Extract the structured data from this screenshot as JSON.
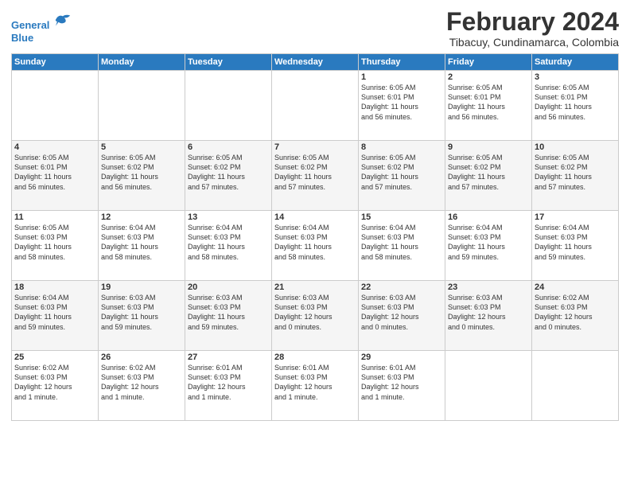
{
  "logo": {
    "line1": "General",
    "line2": "Blue"
  },
  "title": "February 2024",
  "subtitle": "Tibacuy, Cundinamarca, Colombia",
  "headers": [
    "Sunday",
    "Monday",
    "Tuesday",
    "Wednesday",
    "Thursday",
    "Friday",
    "Saturday"
  ],
  "weeks": [
    [
      {
        "day": "",
        "info": ""
      },
      {
        "day": "",
        "info": ""
      },
      {
        "day": "",
        "info": ""
      },
      {
        "day": "",
        "info": ""
      },
      {
        "day": "1",
        "info": "Sunrise: 6:05 AM\nSunset: 6:01 PM\nDaylight: 11 hours\nand 56 minutes."
      },
      {
        "day": "2",
        "info": "Sunrise: 6:05 AM\nSunset: 6:01 PM\nDaylight: 11 hours\nand 56 minutes."
      },
      {
        "day": "3",
        "info": "Sunrise: 6:05 AM\nSunset: 6:01 PM\nDaylight: 11 hours\nand 56 minutes."
      }
    ],
    [
      {
        "day": "4",
        "info": "Sunrise: 6:05 AM\nSunset: 6:01 PM\nDaylight: 11 hours\nand 56 minutes."
      },
      {
        "day": "5",
        "info": "Sunrise: 6:05 AM\nSunset: 6:02 PM\nDaylight: 11 hours\nand 56 minutes."
      },
      {
        "day": "6",
        "info": "Sunrise: 6:05 AM\nSunset: 6:02 PM\nDaylight: 11 hours\nand 57 minutes."
      },
      {
        "day": "7",
        "info": "Sunrise: 6:05 AM\nSunset: 6:02 PM\nDaylight: 11 hours\nand 57 minutes."
      },
      {
        "day": "8",
        "info": "Sunrise: 6:05 AM\nSunset: 6:02 PM\nDaylight: 11 hours\nand 57 minutes."
      },
      {
        "day": "9",
        "info": "Sunrise: 6:05 AM\nSunset: 6:02 PM\nDaylight: 11 hours\nand 57 minutes."
      },
      {
        "day": "10",
        "info": "Sunrise: 6:05 AM\nSunset: 6:02 PM\nDaylight: 11 hours\nand 57 minutes."
      }
    ],
    [
      {
        "day": "11",
        "info": "Sunrise: 6:05 AM\nSunset: 6:03 PM\nDaylight: 11 hours\nand 58 minutes."
      },
      {
        "day": "12",
        "info": "Sunrise: 6:04 AM\nSunset: 6:03 PM\nDaylight: 11 hours\nand 58 minutes."
      },
      {
        "day": "13",
        "info": "Sunrise: 6:04 AM\nSunset: 6:03 PM\nDaylight: 11 hours\nand 58 minutes."
      },
      {
        "day": "14",
        "info": "Sunrise: 6:04 AM\nSunset: 6:03 PM\nDaylight: 11 hours\nand 58 minutes."
      },
      {
        "day": "15",
        "info": "Sunrise: 6:04 AM\nSunset: 6:03 PM\nDaylight: 11 hours\nand 58 minutes."
      },
      {
        "day": "16",
        "info": "Sunrise: 6:04 AM\nSunset: 6:03 PM\nDaylight: 11 hours\nand 59 minutes."
      },
      {
        "day": "17",
        "info": "Sunrise: 6:04 AM\nSunset: 6:03 PM\nDaylight: 11 hours\nand 59 minutes."
      }
    ],
    [
      {
        "day": "18",
        "info": "Sunrise: 6:04 AM\nSunset: 6:03 PM\nDaylight: 11 hours\nand 59 minutes."
      },
      {
        "day": "19",
        "info": "Sunrise: 6:03 AM\nSunset: 6:03 PM\nDaylight: 11 hours\nand 59 minutes."
      },
      {
        "day": "20",
        "info": "Sunrise: 6:03 AM\nSunset: 6:03 PM\nDaylight: 11 hours\nand 59 minutes."
      },
      {
        "day": "21",
        "info": "Sunrise: 6:03 AM\nSunset: 6:03 PM\nDaylight: 12 hours\nand 0 minutes."
      },
      {
        "day": "22",
        "info": "Sunrise: 6:03 AM\nSunset: 6:03 PM\nDaylight: 12 hours\nand 0 minutes."
      },
      {
        "day": "23",
        "info": "Sunrise: 6:03 AM\nSunset: 6:03 PM\nDaylight: 12 hours\nand 0 minutes."
      },
      {
        "day": "24",
        "info": "Sunrise: 6:02 AM\nSunset: 6:03 PM\nDaylight: 12 hours\nand 0 minutes."
      }
    ],
    [
      {
        "day": "25",
        "info": "Sunrise: 6:02 AM\nSunset: 6:03 PM\nDaylight: 12 hours\nand 1 minute."
      },
      {
        "day": "26",
        "info": "Sunrise: 6:02 AM\nSunset: 6:03 PM\nDaylight: 12 hours\nand 1 minute."
      },
      {
        "day": "27",
        "info": "Sunrise: 6:01 AM\nSunset: 6:03 PM\nDaylight: 12 hours\nand 1 minute."
      },
      {
        "day": "28",
        "info": "Sunrise: 6:01 AM\nSunset: 6:03 PM\nDaylight: 12 hours\nand 1 minute."
      },
      {
        "day": "29",
        "info": "Sunrise: 6:01 AM\nSunset: 6:03 PM\nDaylight: 12 hours\nand 1 minute."
      },
      {
        "day": "",
        "info": ""
      },
      {
        "day": "",
        "info": ""
      }
    ]
  ]
}
